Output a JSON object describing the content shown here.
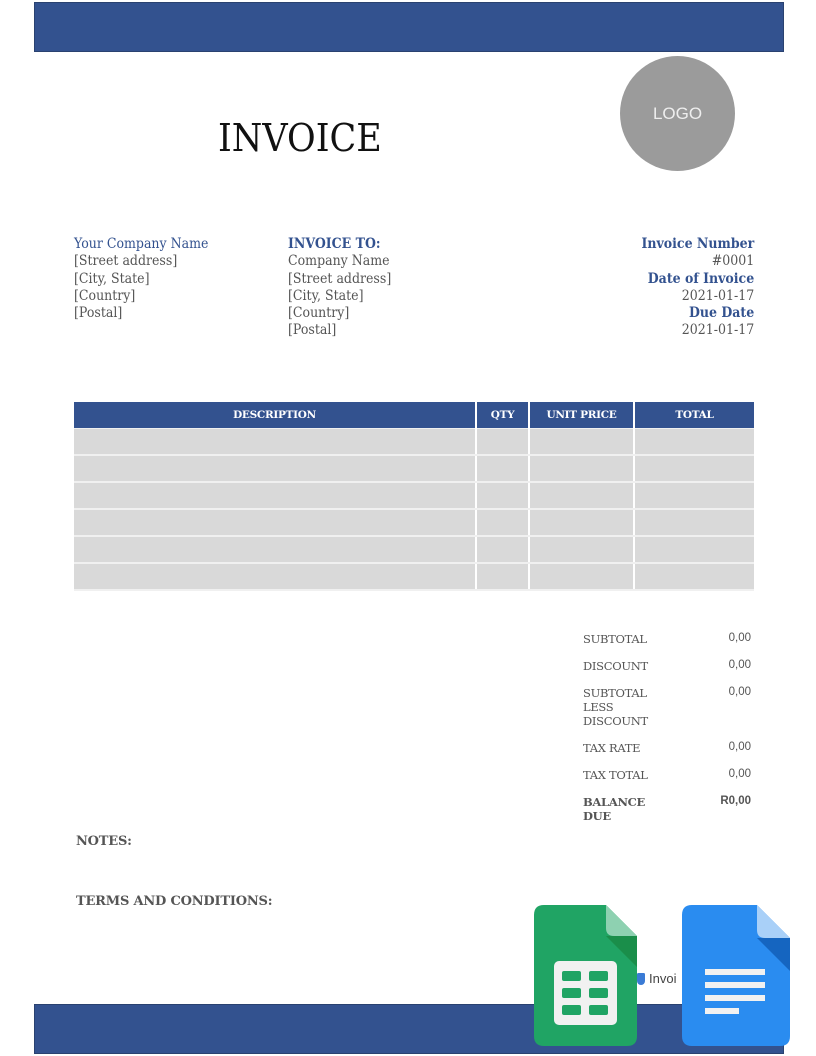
{
  "document": {
    "title": "INVOICE",
    "logo_text": "LOGO",
    "accent_color": "#33528f"
  },
  "from": {
    "company": "Your Company Name",
    "lines": [
      "[Street address]",
      "[City, State]",
      "[Country]",
      "[Postal]"
    ]
  },
  "to": {
    "heading": "INVOICE TO:",
    "lines": [
      "Company Name",
      "[Street address]",
      "[City, State]",
      "[Country]",
      "[Postal]"
    ]
  },
  "meta": {
    "invoice_number_label": "Invoice Number",
    "invoice_number": "#0001",
    "date_label": "Date of Invoice",
    "date": "2021-01-17",
    "due_label": "Due Date",
    "due": "2021-01-17"
  },
  "items_table": {
    "columns": [
      "DESCRIPTION",
      "QTY",
      "UNIT PRICE",
      "TOTAL"
    ],
    "rows": [
      [
        "",
        "",
        "",
        ""
      ],
      [
        "",
        "",
        "",
        ""
      ],
      [
        "",
        "",
        "",
        ""
      ],
      [
        "",
        "",
        "",
        ""
      ],
      [
        "",
        "",
        "",
        ""
      ],
      [
        "",
        "",
        "",
        ""
      ]
    ]
  },
  "summary": [
    {
      "label": "SUBTOTAL",
      "value": "0,00"
    },
    {
      "label": "DISCOUNT",
      "value": "0,00"
    },
    {
      "label": "SUBTOTAL LESS DISCOUNT",
      "value": "0,00"
    },
    {
      "label": "TAX RATE",
      "value": "0,00"
    },
    {
      "label": "TAX TOTAL",
      "value": "0,00"
    },
    {
      "label": "BALANCE DUE",
      "value": "R0,00"
    }
  ],
  "notes_label": "NOTES:",
  "terms_label": "TERMS AND CONDITIONS:",
  "brand_text": "Invoi",
  "overlay_icons": [
    "google-sheets-icon",
    "google-docs-icon"
  ]
}
